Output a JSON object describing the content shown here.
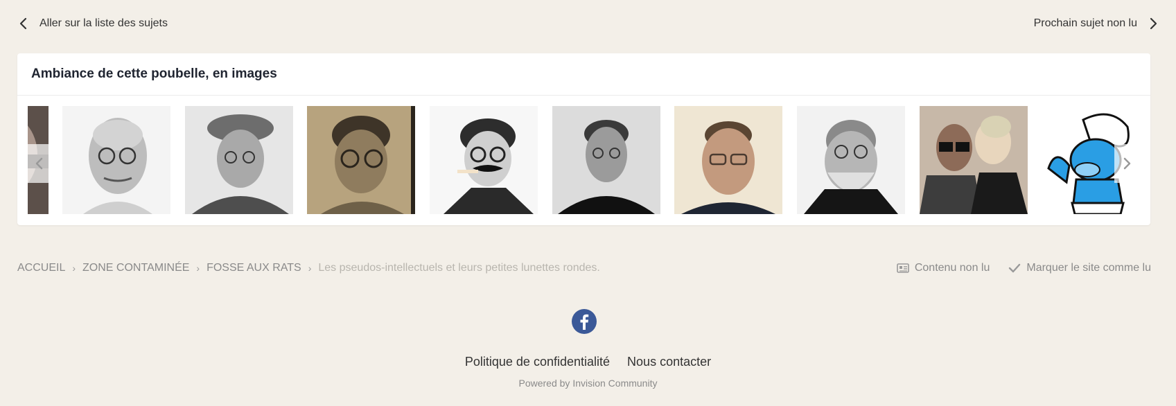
{
  "topnav": {
    "prev_label": "Aller sur la liste des sujets",
    "next_label": "Prochain sujet non lu"
  },
  "gallery": {
    "title": "Ambiance de cette poubelle, en images",
    "thumbnails": [
      {
        "icon": "photo-portrait-partial"
      },
      {
        "icon": "photo-portrait-round-glasses"
      },
      {
        "icon": "photo-portrait-cap"
      },
      {
        "icon": "photo-portrait-sepia-glasses"
      },
      {
        "icon": "photo-portrait-mustache-glasses"
      },
      {
        "icon": "photo-portrait-turtleneck"
      },
      {
        "icon": "photo-portrait-color-glasses"
      },
      {
        "icon": "photo-portrait-bearded"
      },
      {
        "icon": "photo-couple-glasses"
      },
      {
        "icon": "cartoon-smurf"
      }
    ]
  },
  "breadcrumb": {
    "items": [
      "Accueil",
      "Zone contaminée",
      "Fosse aux rats"
    ],
    "current": "Les pseudos-intellectuels et leurs petites lunettes rondes."
  },
  "actions": {
    "unread_label": "Contenu non lu",
    "mark_read_label": "Marquer le site comme lu"
  },
  "footer": {
    "privacy_label": "Politique de confidentialité",
    "contact_label": "Nous contacter",
    "powered": "Powered by Invision Community"
  },
  "colors": {
    "background": "#f3efe8",
    "facebook": "#3b5998",
    "smurf": "#2a9ee4"
  }
}
